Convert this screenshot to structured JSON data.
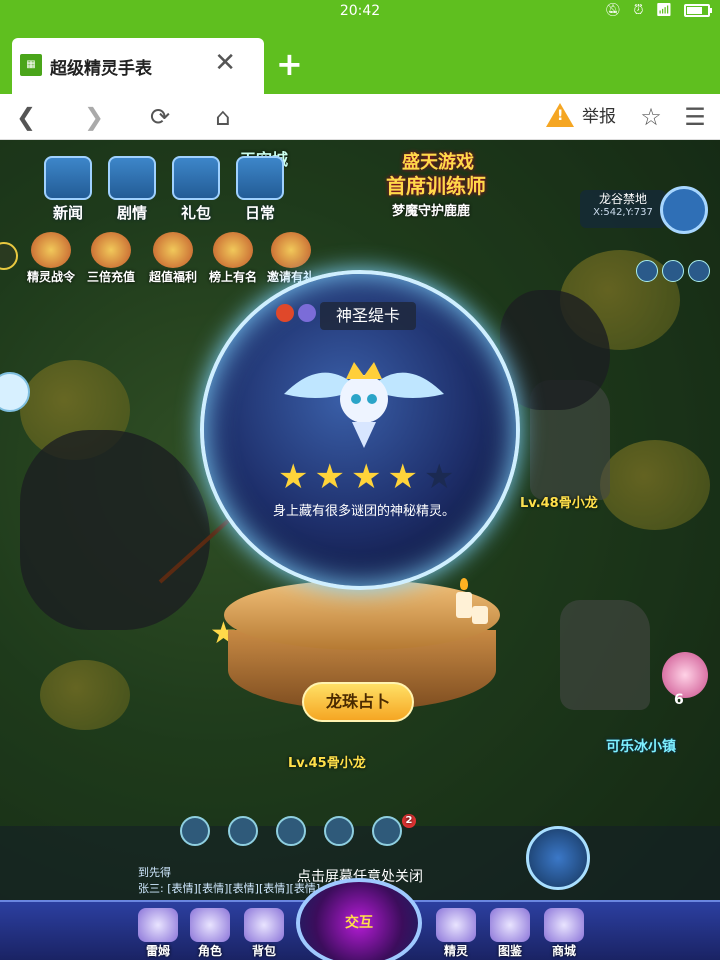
{
  "status_bar": {
    "time": "20:42",
    "battery": 0.75
  },
  "browser": {
    "tab_title": "超级精灵手表",
    "new_tab_symbol": "+",
    "report_label": "举报"
  },
  "game": {
    "area_label": "天空城",
    "top_menu": [
      "新闻",
      "剧情",
      "礼包",
      "日常"
    ],
    "promo_menu": [
      "精灵战令",
      "三倍充值",
      "超值福利",
      "榜上有名",
      "邀请有礼"
    ],
    "banner_line1": "盛天游戏",
    "banner_line2": "首席训练师",
    "npc_title": "梦魔守护鹿鹿",
    "map": {
      "name": "龙谷禁地",
      "coords": "X:542,Y:737"
    },
    "monster_labels": [
      "Lv.48骨小龙",
      "Lv.45骨小龙"
    ],
    "event": {
      "count": "6",
      "name": "可乐冰小镇"
    },
    "spirit_popup": {
      "name": "神圣缇卡",
      "stars": 4,
      "max_stars": 5,
      "description": "身上藏有很多谜团的神秘精灵。",
      "action_button": "龙珠占卜"
    },
    "chat": {
      "line1": "到先得",
      "line2": "张三: [表情][表情][表情][表情][表情]",
      "notify_count": "2"
    },
    "close_hint": "点击屏幕任意处关闭",
    "bottom_nav": [
      "雷姆",
      "角色",
      "背包",
      "交互",
      "精灵",
      "图鉴",
      "商城"
    ]
  }
}
